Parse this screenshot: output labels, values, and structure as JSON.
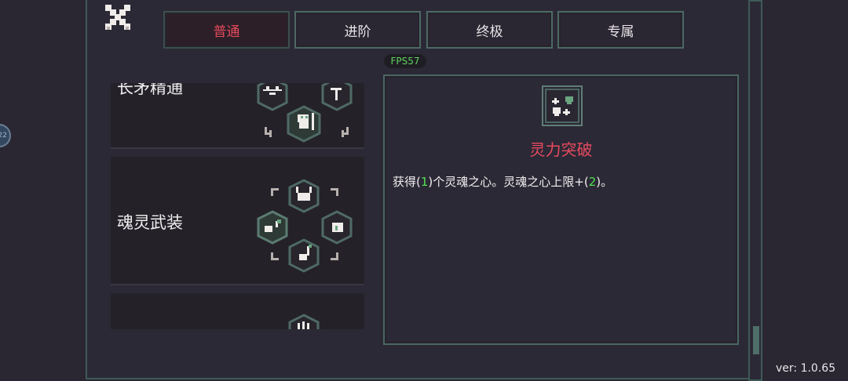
{
  "tabs": [
    {
      "label": "普通",
      "active": true
    },
    {
      "label": "进阶",
      "active": false
    },
    {
      "label": "终极",
      "active": false
    },
    {
      "label": "专属",
      "active": false
    }
  ],
  "fps": "FPS57",
  "side_badge": "22",
  "skill_list": [
    {
      "name": "长矛精通",
      "icons": [
        "spear-icon",
        "crossed-spears-icon",
        "warrior-icon"
      ]
    },
    {
      "name": "魂灵武装",
      "icons": [
        "horned-heart-icon",
        "soul-heart-sparkle-icon",
        "broken-heart-icon",
        "heart-sword-icon"
      ]
    },
    {
      "name": "",
      "icons": [
        "claw-icon"
      ]
    }
  ],
  "detail": {
    "icon": "soul-heart-sparkle-icon",
    "title": "灵力突破",
    "desc_parts": [
      "获得(",
      "1",
      ")个灵魂之心。灵魂之心上限+(",
      "2",
      ")。"
    ]
  },
  "version": "ver: 1.0.65",
  "colors": {
    "accent_red": "#e84a5f",
    "highlight_green": "#4fe24f",
    "frame": "#4b6662"
  }
}
